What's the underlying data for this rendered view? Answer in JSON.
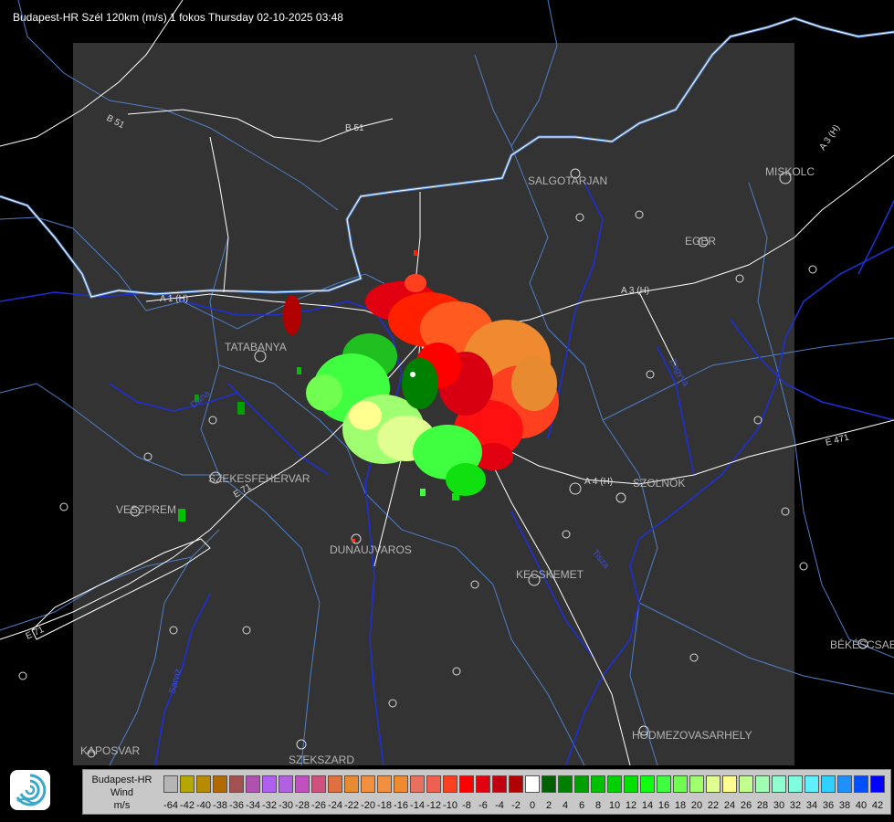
{
  "title": "Budapest-HR Szél 120km (m/s) 1 fokos Thursday 02-10-2025 03:48",
  "map": {
    "cities": [
      "SALGOTARJAN",
      "EGER",
      "MISKOLC",
      "TATABANYA",
      "SZEKESFEHERVAR",
      "VESZPREM",
      "DUNAUJVAROS",
      "KECSKEMET",
      "SZOLNOK",
      "BÉKÉSCSABA",
      "HODMEZOVASARHELY",
      "KAPOSVAR",
      "SZEKSZARD"
    ],
    "roads": [
      "B 51",
      "B 51",
      "A 1 (H)",
      "A 3 (H)",
      "A 3 (H)",
      "A 4 (H)",
      "E 71",
      "E 71",
      "E 471"
    ],
    "rivers": [
      "Duna",
      "Tisza",
      "Sarviz",
      "Zagyva"
    ],
    "colors": {
      "background": "#000000",
      "coverage": "#333333",
      "rivers": "#1f2fd6",
      "roads": "#ffffff",
      "borders": "#4f7fc8"
    }
  },
  "legend": {
    "radar": "Budapest-HR",
    "product": "Wind",
    "unit": "m/s",
    "ticks": [
      "-64",
      "-42",
      "-40",
      "-38",
      "-36",
      "-34",
      "-32",
      "-30",
      "-28",
      "-26",
      "-24",
      "-22",
      "-20",
      "-18",
      "-16",
      "-14",
      "-12",
      "-10",
      "-8",
      "-6",
      "-4",
      "-2",
      "0",
      "2",
      "4",
      "6",
      "8",
      "10",
      "12",
      "14",
      "16",
      "18",
      "20",
      "22",
      "24",
      "26",
      "28",
      "30",
      "32",
      "34",
      "36",
      "38",
      "40",
      "42"
    ],
    "colors": [
      "#b5b5b5",
      "#b4a800",
      "#b88a00",
      "#b06a00",
      "#a35050",
      "#b050b0",
      "#b060f0",
      "#b060e0",
      "#c050c0",
      "#d05080",
      "#e07040",
      "#e88a30",
      "#f09040",
      "#f09040",
      "#f08a30",
      "#e87060",
      "#f06050",
      "#ff4020",
      "#ff0000",
      "#e00010",
      "#c00010",
      "#b00000",
      "#ffffff",
      "#006000",
      "#008000",
      "#00a000",
      "#00c000",
      "#00d000",
      "#00e000",
      "#10ff10",
      "#40ff40",
      "#70ff50",
      "#a0ff70",
      "#e0ff90",
      "#ffff90",
      "#c0ff90",
      "#a0ffb0",
      "#90ffd0",
      "#80ffe0",
      "#60f0ff",
      "#30d0ff",
      "#2090ff",
      "#0050ff",
      "#0000ff"
    ]
  },
  "logo": {
    "icon": "omsz-logo-icon"
  }
}
